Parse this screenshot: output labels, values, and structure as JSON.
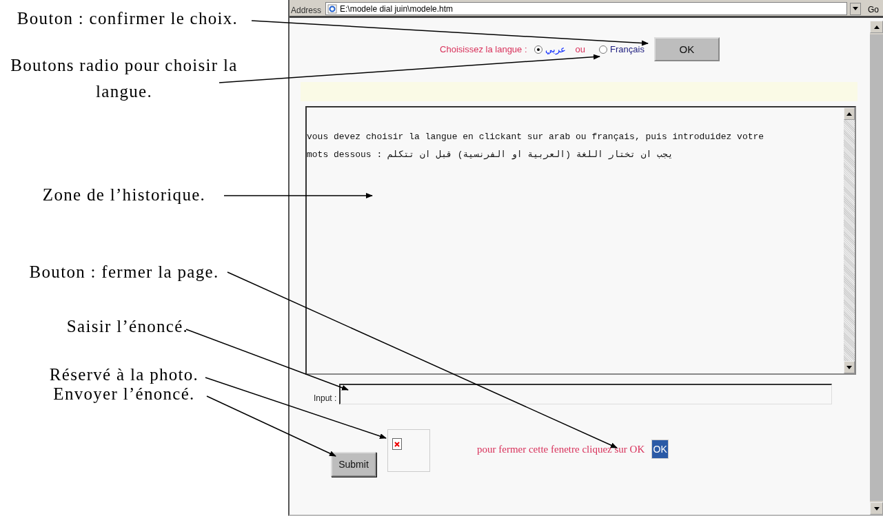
{
  "annotations": [
    {
      "text": "Bouton : confirmer le choix."
    },
    {
      "text": "Boutons radio pour choisir la langue."
    },
    {
      "text": "Zone de l’historique."
    },
    {
      "text": "Bouton : fermer la page."
    },
    {
      "text": "Saisir l’énoncé."
    },
    {
      "text": "Réservé à la photo."
    },
    {
      "text": "Envoyer l’énoncé."
    }
  ],
  "browser": {
    "address_label": "Address",
    "address": "E:\\modele dial juin\\modele.htm",
    "go_button": "Go"
  },
  "language_choice": {
    "label": "Choisissez la langue :",
    "options": [
      {
        "label": "عربي",
        "selected": true
      },
      {
        "label": "Français",
        "selected": false
      }
    ],
    "separator": "ou",
    "ok_button": "OK"
  },
  "history": {
    "lines": [
      "vous devez choisir la langue en clickant sur arab ou français, puis introduidez votre",
      "mots dessous : يجب ان تختار اللغة (العربية او الفرنسية) قبل ان تتكلم"
    ]
  },
  "input": {
    "label": "Input :"
  },
  "submit_button": "Submit",
  "close_note": "pour fermer cette fenetre cliquez sur OK",
  "close_button": "OK"
}
